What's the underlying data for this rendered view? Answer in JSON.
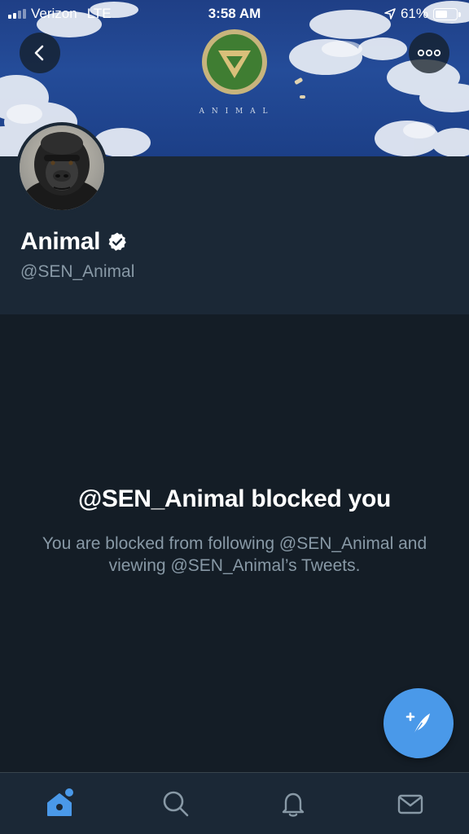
{
  "status_bar": {
    "carrier": "Verizon",
    "network": "LTE",
    "time": "3:58 AM",
    "battery": "61%",
    "battery_level": 0.61
  },
  "banner": {
    "logo_text": "A N I M A L"
  },
  "profile": {
    "display_name": "Animal",
    "handle": "@SEN_Animal",
    "verified": true
  },
  "blocked": {
    "title": "@SEN_Animal blocked you",
    "description": "You are blocked from following @SEN_Animal and viewing @SEN_Animal’s Tweets."
  },
  "icons": {
    "back": "chevron-left-icon",
    "more": "more-horizontal-icon",
    "verified": "verified-badge-icon",
    "compose": "compose-tweet-icon",
    "home": "home-icon",
    "search": "search-icon",
    "notifications": "bell-icon",
    "messages": "mail-icon"
  },
  "colors": {
    "background": "#141d26",
    "header": "#1b2836",
    "secondary_text": "#8899a6",
    "accent": "#4a99e9"
  }
}
